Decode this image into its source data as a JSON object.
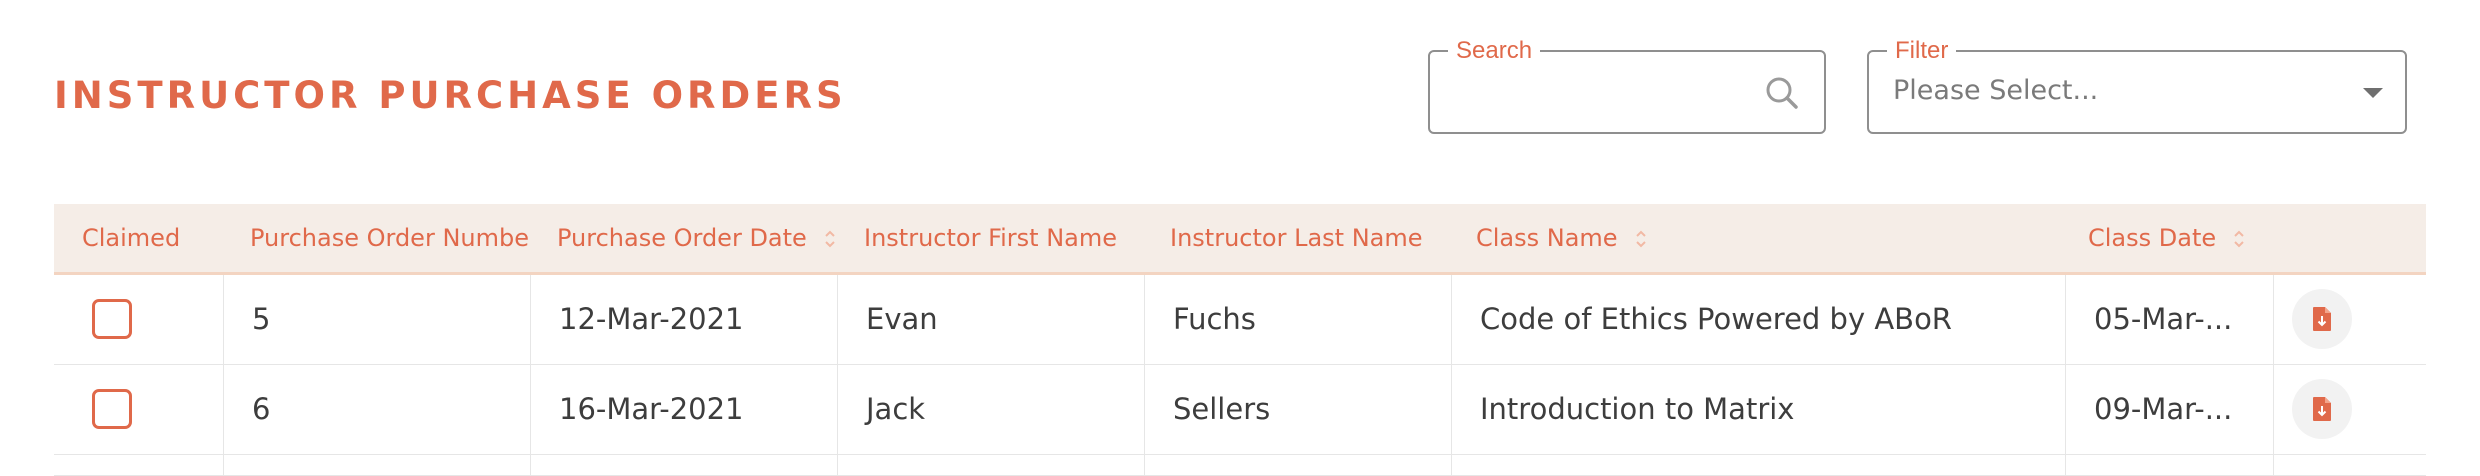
{
  "page": {
    "title": "INSTRUCTOR PURCHASE ORDERS"
  },
  "search": {
    "label": "Search",
    "value": "",
    "placeholder": ""
  },
  "filter": {
    "label": "Filter",
    "selected": "Please Select..."
  },
  "colors": {
    "accent": "#e0694a",
    "header_bg": "#f5ede7"
  },
  "table": {
    "columns": [
      {
        "label": "Claimed",
        "sortable": false
      },
      {
        "label": "Purchase Order Number",
        "sortable": true
      },
      {
        "label": "Purchase Order Date",
        "sortable": true
      },
      {
        "label": "Instructor First Name",
        "sortable": false
      },
      {
        "label": "Instructor Last Name",
        "sortable": false
      },
      {
        "label": "Class Name",
        "sortable": true
      },
      {
        "label": "Class Date",
        "sortable": true
      }
    ],
    "rows": [
      {
        "claimed": false,
        "po_number": "5",
        "po_date": "12-Mar-2021",
        "first_name": "Evan",
        "last_name": "Fuchs",
        "class_name": "Code of Ethics Powered by ABoR",
        "class_date": "05-Mar-...",
        "action_icon": "pdf-download-icon"
      },
      {
        "claimed": false,
        "po_number": "6",
        "po_date": "16-Mar-2021",
        "first_name": "Jack",
        "last_name": "Sellers",
        "class_name": "Introduction to Matrix",
        "class_date": "09-Mar-...",
        "action_icon": "pdf-download-icon"
      }
    ]
  }
}
